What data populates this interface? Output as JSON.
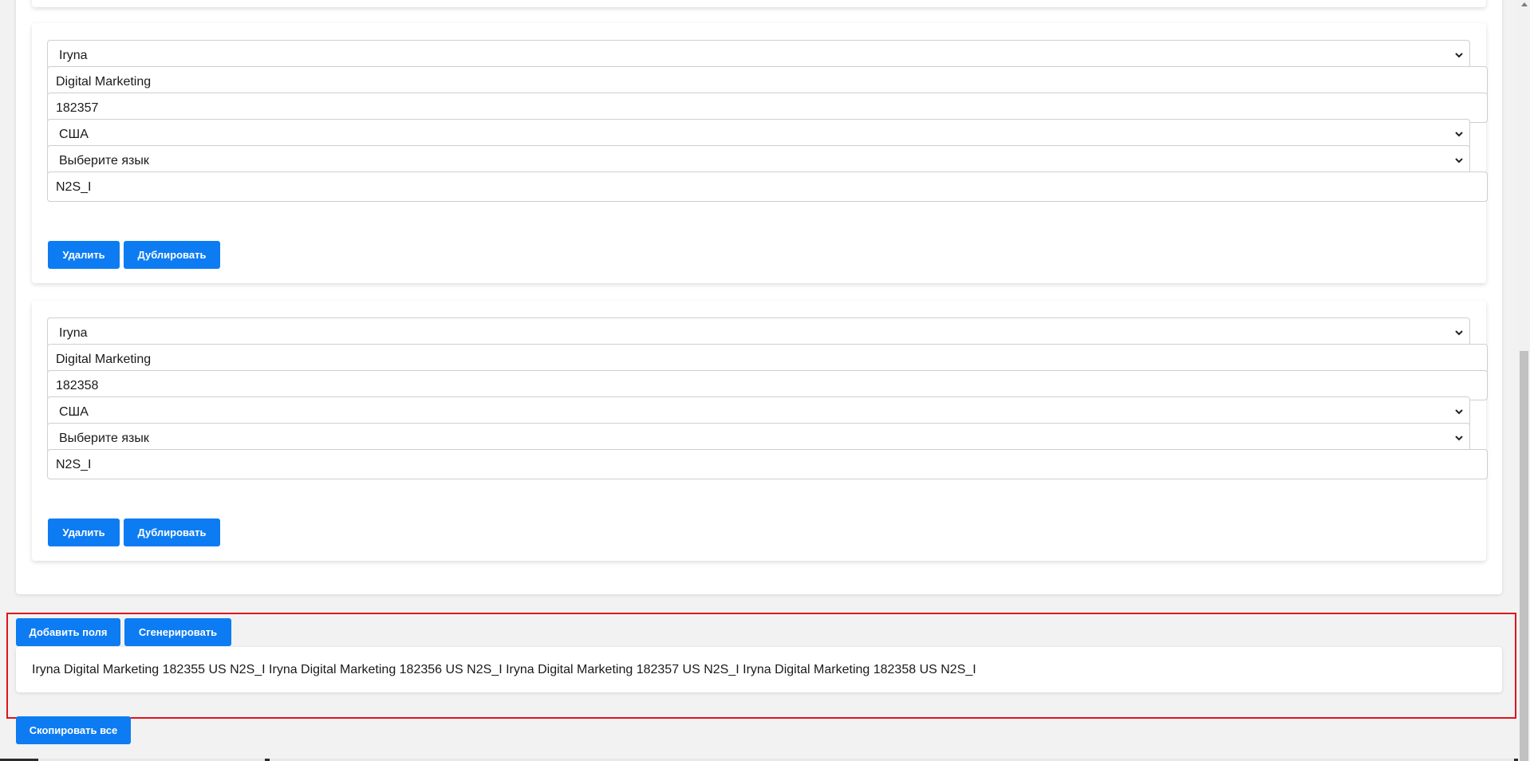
{
  "entries": [
    {
      "name": "Iryna",
      "department": "Digital Marketing",
      "id": "182357",
      "country": "США",
      "language": "Выберите язык",
      "code": "N2S_I",
      "delete_label": "Удалить",
      "duplicate_label": "Дублировать"
    },
    {
      "name": "Iryna",
      "department": "Digital Marketing",
      "id": "182358",
      "country": "США",
      "language": "Выберите язык",
      "code": "N2S_I",
      "delete_label": "Удалить",
      "duplicate_label": "Дублировать"
    }
  ],
  "actions": {
    "add_fields_label": "Добавить поля",
    "generate_label": "Сгенерировать",
    "copy_all_label": "Скопировать все"
  },
  "output": {
    "text": "Iryna Digital Marketing 182355 US N2S_I Iryna Digital Marketing 182356 US N2S_I Iryna Digital Marketing 182357 US N2S_I Iryna Digital Marketing 182358 US N2S_I"
  },
  "colors": {
    "accent": "#0d7cf2",
    "highlight_border": "#e0141c",
    "background": "#f2f2f2"
  },
  "icons": [
    "chevron-down-icon",
    "scroll-up-arrow-icon"
  ]
}
